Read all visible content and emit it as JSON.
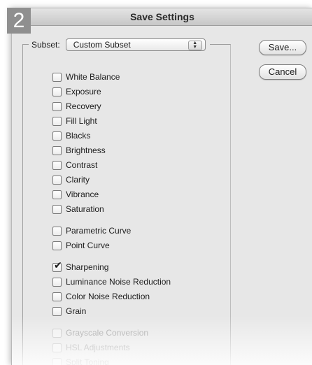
{
  "step_number": "2",
  "window": {
    "title": "Save Settings"
  },
  "subset": {
    "label": "Subset:",
    "selected": "Custom Subset"
  },
  "buttons": {
    "save": "Save...",
    "cancel": "Cancel"
  },
  "options": [
    {
      "label": "White Balance",
      "checked": false,
      "enabled": true
    },
    {
      "label": "Exposure",
      "checked": false,
      "enabled": true
    },
    {
      "label": "Recovery",
      "checked": false,
      "enabled": true
    },
    {
      "label": "Fill Light",
      "checked": false,
      "enabled": true
    },
    {
      "label": "Blacks",
      "checked": false,
      "enabled": true
    },
    {
      "label": "Brightness",
      "checked": false,
      "enabled": true
    },
    {
      "label": "Contrast",
      "checked": false,
      "enabled": true
    },
    {
      "label": "Clarity",
      "checked": false,
      "enabled": true
    },
    {
      "label": "Vibrance",
      "checked": false,
      "enabled": true
    },
    {
      "label": "Saturation",
      "checked": false,
      "enabled": true
    },
    {
      "label": "Parametric Curve",
      "checked": false,
      "enabled": true
    },
    {
      "label": "Point Curve",
      "checked": false,
      "enabled": true
    },
    {
      "label": "Sharpening",
      "checked": true,
      "enabled": true
    },
    {
      "label": "Luminance Noise Reduction",
      "checked": false,
      "enabled": true
    },
    {
      "label": "Color Noise Reduction",
      "checked": false,
      "enabled": true
    },
    {
      "label": "Grain",
      "checked": false,
      "enabled": true
    },
    {
      "label": "Grayscale Conversion",
      "checked": false,
      "enabled": false
    },
    {
      "label": "HSL Adjustments",
      "checked": false,
      "enabled": false
    },
    {
      "label": "Split Toning",
      "checked": false,
      "enabled": false
    }
  ]
}
